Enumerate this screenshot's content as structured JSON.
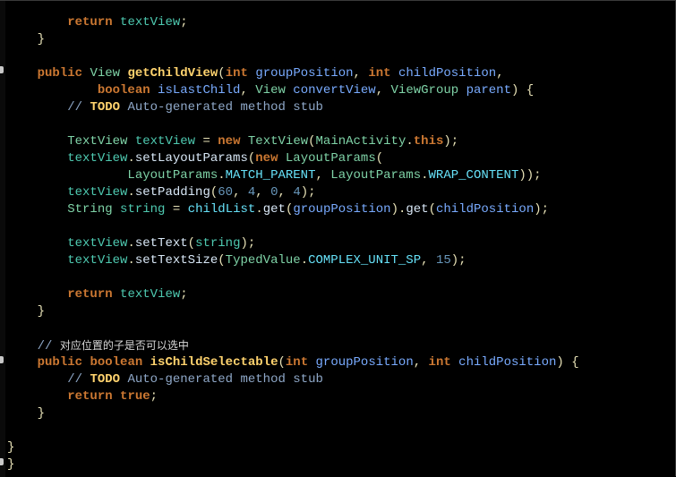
{
  "editor": {
    "lines": [
      "        return textView;",
      "    }",
      "",
      "    public View getChildView(int groupPosition, int childPosition,",
      "            boolean isLastChild, View convertView, ViewGroup parent) {",
      "        // TODO Auto-generated method stub",
      "",
      "        TextView textView = new TextView(MainActivity.this);",
      "        textView.setLayoutParams(new LayoutParams(",
      "                LayoutParams.MATCH_PARENT, LayoutParams.WRAP_CONTENT));",
      "        textView.setPadding(60, 4, 0, 4);",
      "        String string = childList.get(groupPosition).get(childPosition);",
      "",
      "        textView.setText(string);",
      "        textView.setTextSize(TypedValue.COMPLEX_UNIT_SP, 15);",
      "",
      "        return textView;",
      "    }",
      "",
      "    // 对应位置的子是否可以选中",
      "    public boolean isChildSelectable(int groupPosition, int childPosition) {",
      "        // TODO Auto-generated method stub",
      "        return true;",
      "    }",
      "",
      "}",
      "}"
    ],
    "fold_marker_lines": [
      4,
      21,
      27
    ],
    "colors": {
      "background": "#000000",
      "keyword": "#cc7832",
      "method_decl": "#ffd36e",
      "type": "#7fd3a7",
      "parameter": "#79abff",
      "local_variable": "#4ec9b0",
      "field": "#66e1f8",
      "number": "#6897bb",
      "comment": "#8fa8c8"
    }
  }
}
